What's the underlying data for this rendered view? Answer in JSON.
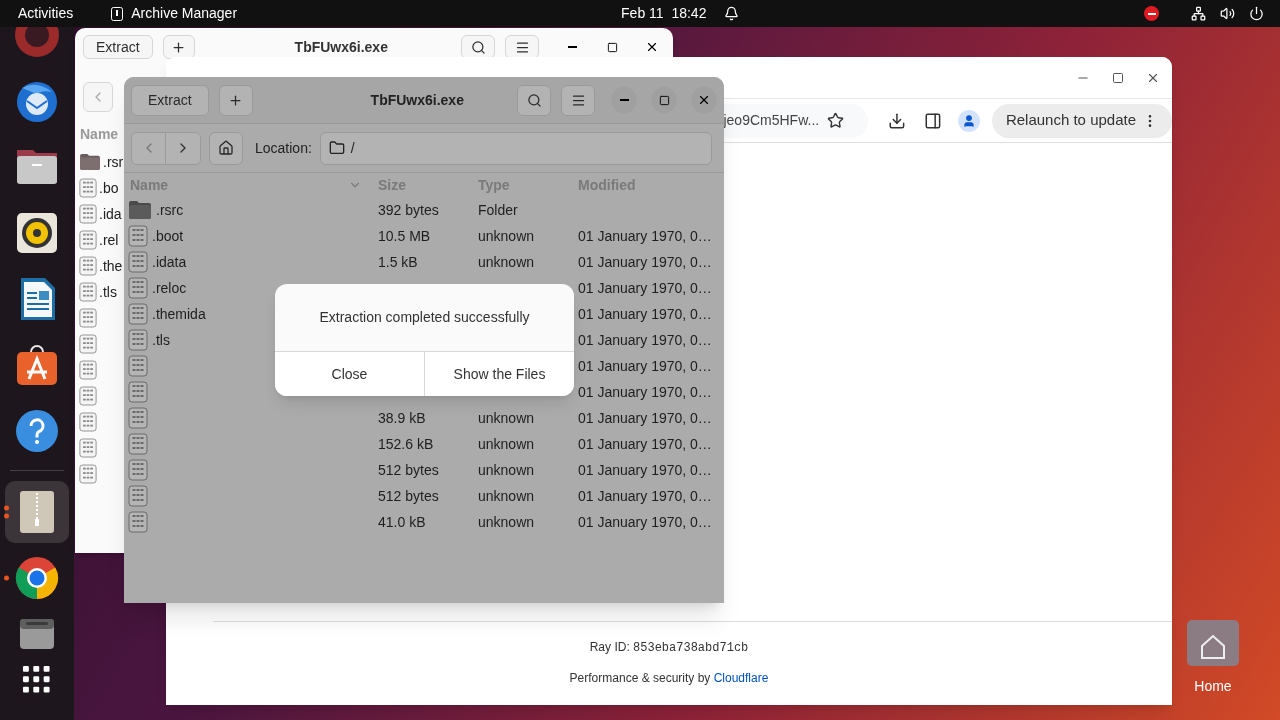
{
  "top_bar": {
    "activities": "Activities",
    "app_name": "Archive Manager",
    "clock": "Feb 11  18:42"
  },
  "dock": {
    "favorites": [
      {
        "kind": "ubuntu",
        "selected": false,
        "running": false
      },
      {
        "kind": "thunderbird",
        "selected": false,
        "running": false
      },
      {
        "kind": "files",
        "selected": false,
        "running": false
      },
      {
        "kind": "rhythmbox",
        "selected": false,
        "running": false
      },
      {
        "kind": "writer",
        "selected": false,
        "running": false
      },
      {
        "kind": "appcenter",
        "selected": false,
        "running": false
      },
      {
        "kind": "help",
        "selected": false,
        "running": false
      }
    ],
    "others": [
      {
        "kind": "archive",
        "selected": true,
        "running": true,
        "multiple_windows": true
      },
      {
        "kind": "chrome",
        "selected": false,
        "running": true,
        "multiple_windows": false
      },
      {
        "kind": "drive",
        "selected": false,
        "running": false
      },
      {
        "kind": "apps",
        "selected": false,
        "running": false
      }
    ]
  },
  "back_window": {
    "title": "TbFUwx6i.exe",
    "extract": "Extract",
    "column_name": "Name",
    "rows": [
      {
        "kind": "folder",
        "name": ".rsr"
      },
      {
        "kind": "file",
        "name": ".bo"
      },
      {
        "kind": "file",
        "name": ".ida"
      },
      {
        "kind": "file",
        "name": ".rel"
      },
      {
        "kind": "file",
        "name": ".the"
      },
      {
        "kind": "file",
        "name": ".tls"
      },
      {
        "kind": "file"
      },
      {
        "kind": "file"
      },
      {
        "kind": "file"
      },
      {
        "kind": "file"
      },
      {
        "kind": "file"
      },
      {
        "kind": "file"
      },
      {
        "kind": "file"
      }
    ]
  },
  "browser": {
    "address": "jeo9Cm5HFw...",
    "relaunch": "Relaunch to update",
    "ray_id_label": "Ray ID:",
    "ray_id": "853eba738abd71cb",
    "footer_text": "Performance & security by",
    "footer_link": "Cloudflare"
  },
  "archive_window": {
    "title": "TbFUwx6i.exe",
    "extract": "Extract",
    "location_label": "Location:",
    "location": "/",
    "columns": [
      {
        "label": "Name",
        "sorted": true
      },
      {
        "label": "Size",
        "sorted": false
      },
      {
        "label": "Type",
        "sorted": false
      },
      {
        "label": "Modified",
        "sorted": false
      }
    ],
    "rows": [
      {
        "kind": "folder",
        "name": ".rsrc",
        "size": "392 bytes",
        "type": "Folder"
      },
      {
        "kind": "file",
        "name": ".boot",
        "size": "10.5 MB",
        "type": "unknown",
        "modified": "01 January 1970, 0…"
      },
      {
        "kind": "file",
        "name": ".idata",
        "size": "1.5 kB",
        "type": "unknown",
        "modified": "01 January 1970, 0…"
      },
      {
        "kind": "file",
        "name": ".reloc",
        "modified": "01 January 1970, 0…"
      },
      {
        "kind": "file",
        "name": ".themida",
        "modified": "01 January 1970, 0…"
      },
      {
        "kind": "file",
        "name": ".tls",
        "modified": "01 January 1970, 0…"
      },
      {
        "kind": "file",
        "modified": "01 January 1970, 0…"
      },
      {
        "kind": "file",
        "modified": "01 January 1970, 0…"
      },
      {
        "kind": "file",
        "size": "38.9 kB",
        "type": "unknown",
        "modified": "01 January 1970, 0…"
      },
      {
        "kind": "file",
        "size": "152.6 kB",
        "type": "unknown",
        "modified": "01 January 1970, 0…"
      },
      {
        "kind": "file",
        "size": "512 bytes",
        "type": "unknown",
        "modified": "01 January 1970, 0…"
      },
      {
        "kind": "file",
        "size": "512 bytes",
        "type": "unknown",
        "modified": "01 January 1970, 0…"
      },
      {
        "kind": "file",
        "size": "41.0 kB",
        "type": "unknown",
        "modified": "01 January 1970, 0…"
      }
    ]
  },
  "dialog": {
    "message": "Extraction completed successfully",
    "buttons": [
      "Close",
      "Show the Files"
    ]
  },
  "desktop": {
    "home_label": "Home"
  }
}
